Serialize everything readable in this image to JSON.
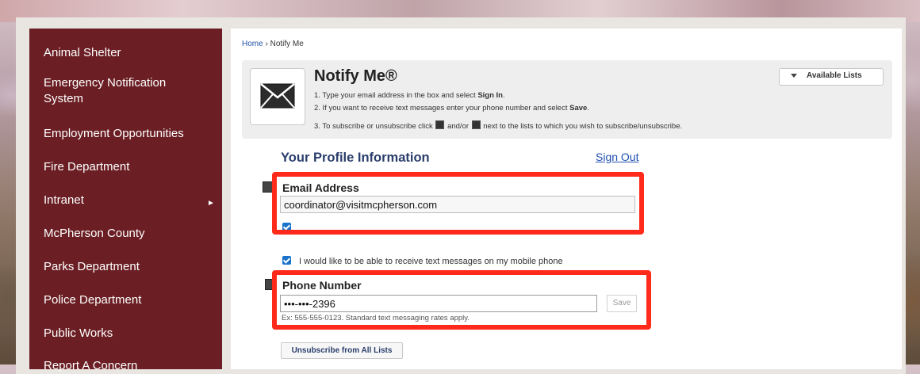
{
  "sidebar": {
    "items": [
      {
        "label": "Animal Shelter"
      },
      {
        "label": "Emergency Notification System"
      },
      {
        "label": "Employment Opportunities"
      },
      {
        "label": "Fire Department"
      },
      {
        "label": "Intranet",
        "has_submenu": true,
        "submenu_glyph": "►"
      },
      {
        "label": "McPherson County"
      },
      {
        "label": "Parks Department"
      },
      {
        "label": "Police Department"
      },
      {
        "label": "Public Works"
      },
      {
        "label": "Report A Concern"
      }
    ]
  },
  "breadcrumb": {
    "home": "Home",
    "separator": "›",
    "current": "Notify Me"
  },
  "notify": {
    "title": "Notify Me®",
    "step1_pre": "1. Type your email address in the box and select ",
    "step1_bold": "Sign In",
    "step1_post": ".",
    "step2_pre": "2. If you want to receive text messages enter your phone number and select ",
    "step2_bold": "Save",
    "step2_post": ".",
    "step3_pre": "3. To subscribe or unsubscribe click ",
    "step3_mid": " and/or ",
    "step3_post": " next to the lists to which you wish to subscribe/unsubscribe.",
    "available_lists": "Available Lists"
  },
  "profile": {
    "title": "Your Profile Information",
    "sign_out": "Sign Out",
    "email_label": "Email Address",
    "email_value": "coordinator@visitmcpherson.com",
    "text_checkbox_label": "I would like to be able to receive text messages on my mobile phone",
    "text_checkbox_checked": true,
    "phone_label": "Phone Number",
    "phone_value": "•••-•••-2396",
    "save_label": "Save",
    "hint": "Ex: 555-555-0123. Standard text messaging rates apply.",
    "unsubscribe_all": "Unsubscribe from All Lists"
  },
  "colors": {
    "sidebar_bg": "#6b1f24",
    "highlight": "#ff2a1a",
    "heading": "#2a3e6c",
    "link": "#1f4fb0"
  }
}
